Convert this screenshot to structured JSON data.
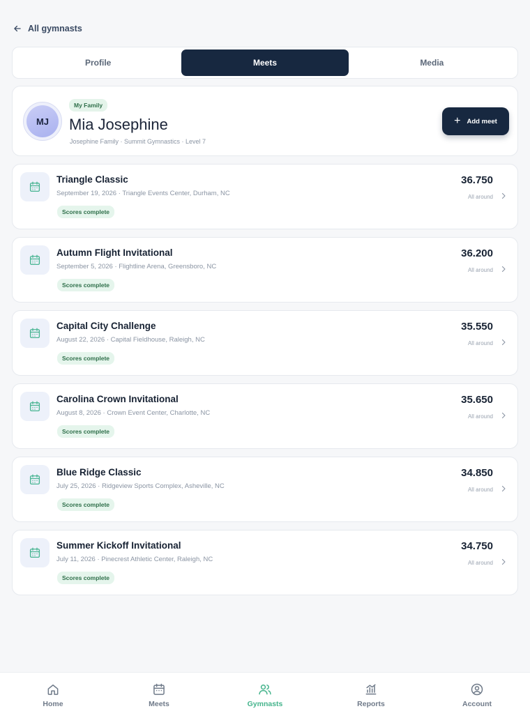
{
  "header": {
    "back_label": "All gymnasts"
  },
  "tabs": [
    {
      "label": "Profile",
      "active": false
    },
    {
      "label": "Meets",
      "active": true
    },
    {
      "label": "Media",
      "active": false
    }
  ],
  "gymnast": {
    "initials": "MJ",
    "badge": "My Family",
    "name": "Mia Josephine",
    "subtitle": "Josephine Family · Summit Gymnastics · Level 7",
    "add_button": "Add meet"
  },
  "meets": [
    {
      "title": "Triangle Classic",
      "detail": "September 19, 2026 · Triangle Events Center, Durham, NC",
      "status": "Scores complete",
      "score": "36.750",
      "score_label": "All around"
    },
    {
      "title": "Autumn Flight Invitational",
      "detail": "September 5, 2026 · Flightline Arena, Greensboro, NC",
      "status": "Scores complete",
      "score": "36.200",
      "score_label": "All around"
    },
    {
      "title": "Capital City Challenge",
      "detail": "August 22, 2026 · Capital Fieldhouse, Raleigh, NC",
      "status": "Scores complete",
      "score": "35.550",
      "score_label": "All around"
    },
    {
      "title": "Carolina Crown Invitational",
      "detail": "August 8, 2026 · Crown Event Center, Charlotte, NC",
      "status": "Scores complete",
      "score": "35.650",
      "score_label": "All around"
    },
    {
      "title": "Blue Ridge Classic",
      "detail": "July 25, 2026 · Ridgeview Sports Complex, Asheville, NC",
      "status": "Scores complete",
      "score": "34.850",
      "score_label": "All around"
    },
    {
      "title": "Summer Kickoff Invitational",
      "detail": "July 11, 2026 · Pinecrest Athletic Center, Raleigh, NC",
      "status": "Scores complete",
      "score": "34.750",
      "score_label": "All around"
    }
  ],
  "nav": [
    {
      "label": "Home",
      "icon": "home-icon",
      "active": false
    },
    {
      "label": "Meets",
      "icon": "calendar-icon",
      "active": false
    },
    {
      "label": "Gymnasts",
      "icon": "users-icon",
      "active": true
    },
    {
      "label": "Reports",
      "icon": "chart-icon",
      "active": false
    },
    {
      "label": "Account",
      "icon": "account-icon",
      "active": false
    }
  ],
  "colors": {
    "primary": "#172840",
    "accent": "#45b48c",
    "badge_bg": "#e5f5ec",
    "badge_text": "#2f6f4a",
    "background": "#f6f7f9"
  }
}
